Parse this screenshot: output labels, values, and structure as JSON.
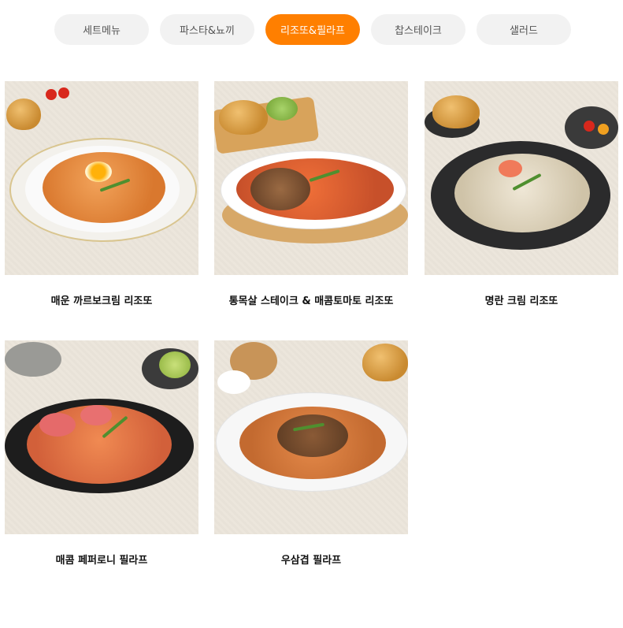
{
  "tabs": [
    {
      "label": "세트메뉴",
      "active": false
    },
    {
      "label": "파스타&뇨끼",
      "active": false
    },
    {
      "label": "리조또&필라프",
      "active": true
    },
    {
      "label": "찹스테이크",
      "active": false
    },
    {
      "label": "샐러드",
      "active": false
    }
  ],
  "menu": [
    {
      "name": "매운 까르보크림 리조또"
    },
    {
      "name": "통목살 스테이크 & 매콤토마토 리조또"
    },
    {
      "name": "명란 크림 리조또"
    },
    {
      "name": "매콤 페퍼로니 필라프"
    },
    {
      "name": "우삼겹 필라프"
    }
  ],
  "colors": {
    "accent": "#ff7f00",
    "tab_bg": "#f2f2f2"
  }
}
